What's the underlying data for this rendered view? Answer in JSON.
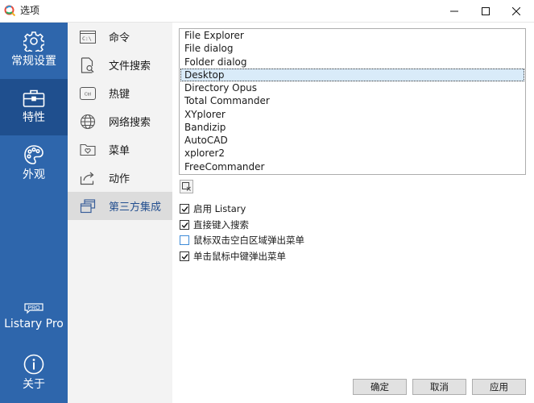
{
  "window": {
    "title": "选项",
    "app_icon": "search-app-icon",
    "controls": [
      "minimize-icon",
      "maximize-icon",
      "close-icon"
    ]
  },
  "nav_main": [
    {
      "label": "常规设置",
      "icon": "gear-icon"
    },
    {
      "label": "特性",
      "icon": "toolbox-icon",
      "active": true
    },
    {
      "label": "外观",
      "icon": "palette-icon"
    },
    {
      "label": "Listary Pro",
      "icon": "pro-badge-icon"
    },
    {
      "label": "关于",
      "icon": "info-icon"
    }
  ],
  "nav_sub": [
    {
      "label": "命令",
      "icon": "command-prompt-icon"
    },
    {
      "label": "文件搜索",
      "icon": "file-search-icon"
    },
    {
      "label": "热键",
      "icon": "ctrl-key-icon"
    },
    {
      "label": "网络搜索",
      "icon": "globe-icon"
    },
    {
      "label": "菜单",
      "icon": "folder-heart-icon"
    },
    {
      "label": "动作",
      "icon": "share-arrow-icon"
    },
    {
      "label": "第三方集成",
      "icon": "windows-stack-icon",
      "active": true
    }
  ],
  "integrations": {
    "items": [
      "File Explorer",
      "File dialog",
      "Folder dialog",
      "Desktop",
      "Directory Opus",
      "Total Commander",
      "XYplorer",
      "Bandizip",
      "AutoCAD",
      "xplorer2",
      "FreeCommander"
    ],
    "selected": "Desktop"
  },
  "options": [
    {
      "label": "启用 Listary",
      "checked": true
    },
    {
      "label": "直接键入搜索",
      "checked": true
    },
    {
      "label": "鼠标双击空白区域弹出菜单",
      "checked": false
    },
    {
      "label": "单击鼠标中键弹出菜单",
      "checked": true
    }
  ],
  "buttons": {
    "ok": "确定",
    "cancel": "取消",
    "apply": "应用"
  },
  "colors": {
    "sidebar": "#2e66ac",
    "sidebar_active": "#1f4f8e",
    "accent_text": "#234f8f"
  }
}
